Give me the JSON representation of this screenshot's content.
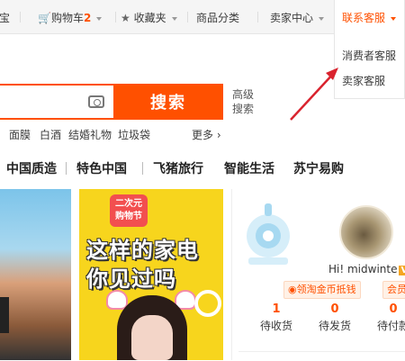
{
  "topbar": {
    "item0": "宝",
    "cart_label": "购物车",
    "cart_count": "2",
    "favorites_label": "收藏夹",
    "categories_label": "商品分类",
    "seller_center_label": "卖家中心",
    "contact_label": "联系客服"
  },
  "contact_menu": {
    "items": [
      "消费者客服",
      "卖家客服"
    ]
  },
  "search": {
    "button_label": "搜索",
    "advanced_label": "高级搜索"
  },
  "hot_words": [
    "面膜",
    "白酒",
    "结婚礼物",
    "垃圾袋"
  ],
  "more_label": "更多",
  "nav_items": [
    "中国质造",
    "特色中国",
    "飞猪旅行",
    "智能生活",
    "苏宁易购"
  ],
  "banner": {
    "badge_line1": "二次元",
    "badge_line2": "购物节",
    "line1": "这样的家电",
    "line2": "你见过吗"
  },
  "user": {
    "greeting": "Hi! midwinte",
    "vip_label": "V",
    "gold_coin_label": "领淘金币抵钱",
    "member_label": "会员",
    "stats": [
      {
        "count": "1",
        "label": "待收货"
      },
      {
        "count": "0",
        "label": "待发货"
      },
      {
        "count": "0",
        "label": "待付款"
      }
    ]
  },
  "colors": {
    "accent": "#ff5000",
    "arrow": "#d9232e"
  }
}
